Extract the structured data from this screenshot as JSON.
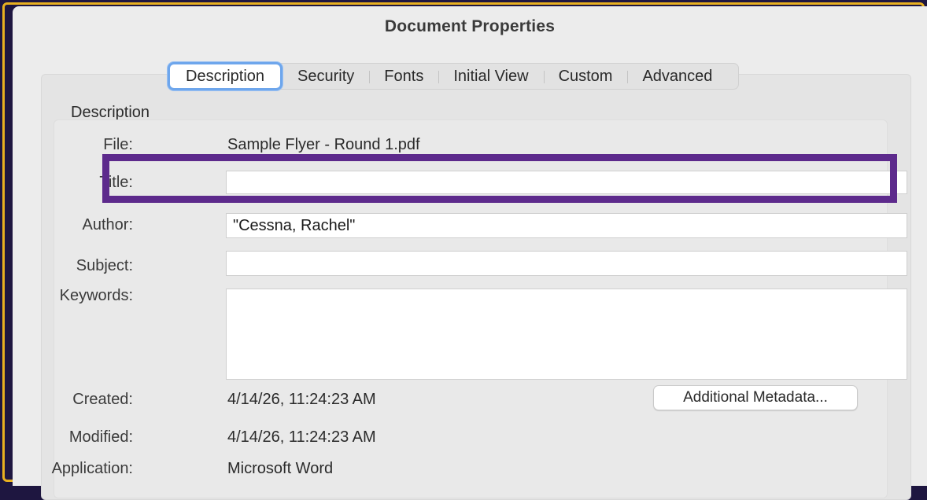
{
  "dialog": {
    "title": "Document Properties"
  },
  "tabs": [
    {
      "label": "Description",
      "active": true
    },
    {
      "label": "Security",
      "active": false
    },
    {
      "label": "Fonts",
      "active": false
    },
    {
      "label": "Initial View",
      "active": false
    },
    {
      "label": "Custom",
      "active": false
    },
    {
      "label": "Advanced",
      "active": false
    }
  ],
  "description": {
    "group_label": "Description",
    "file_label": "File:",
    "file_value": "Sample Flyer - Round 1.pdf",
    "title_label": "Title:",
    "title_value": "",
    "author_label": "Author:",
    "author_value": "\"Cessna, Rachel\"",
    "subject_label": "Subject:",
    "subject_value": "",
    "keywords_label": "Keywords:",
    "keywords_value": "",
    "created_label": "Created:",
    "created_value": "4/14/26, 11:24:23 AM",
    "modified_label": "Modified:",
    "modified_value": "4/14/26, 11:24:23 AM",
    "application_label": "Application:",
    "application_value": "Microsoft Word",
    "additional_metadata_button": "Additional Metadata..."
  },
  "colors": {
    "highlight_box": "#5d2a8c",
    "active_tab_ring": "#6ea6ec",
    "outer_border": "#e8b020"
  }
}
